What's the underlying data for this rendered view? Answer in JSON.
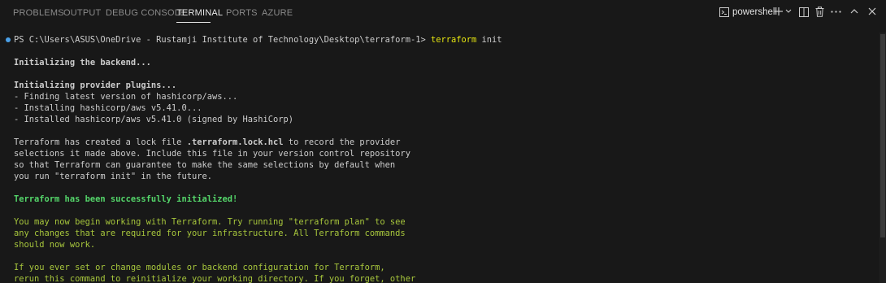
{
  "panel": {
    "tabs": [
      {
        "label": "PROBLEMS"
      },
      {
        "label": "OUTPUT"
      },
      {
        "label": "DEBUG CONSOLE"
      },
      {
        "label": "TERMINAL"
      },
      {
        "label": "PORTS"
      },
      {
        "label": "AZURE"
      }
    ],
    "active_tab": "TERMINAL",
    "shell_name": "powershell"
  },
  "terminal": {
    "prompt": "PS C:\\Users\\ASUS\\OneDrive - Rustamji Institute of Technology\\Desktop\\terraform-1> ",
    "command": "terraform",
    "command_args": " init",
    "backend": "Initializing the backend...",
    "provider_heading": "Initializing provider plugins...",
    "provider_lines": [
      "- Finding latest version of hashicorp/aws...",
      "- Installing hashicorp/aws v5.41.0...",
      "- Installed hashicorp/aws v5.41.0 (signed by HashiCorp)"
    ],
    "lock_pre": "Terraform has created a lock file ",
    "lock_file": ".terraform.lock.hcl",
    "lock_post": " to record the provider",
    "lock_lines": [
      "selections it made above. Include this file in your version control repository",
      "so that Terraform can guarantee to make the same selections by default when",
      "you run \"terraform init\" in the future."
    ],
    "success": "Terraform has been successfully initialized!",
    "next_lines": [
      "You may now begin working with Terraform. Try running \"terraform plan\" to see",
      "any changes that are required for your infrastructure. All Terraform commands",
      "should now work."
    ],
    "modules_lines": [
      "If you ever set or change modules or backend configuration for Terraform,",
      "rerun this command to reinitialize your working directory. If you forget, other"
    ]
  },
  "colors": {
    "background": "#181818",
    "command": "#e5e510",
    "success": "#54d66a",
    "hint": "#a7c63c"
  }
}
